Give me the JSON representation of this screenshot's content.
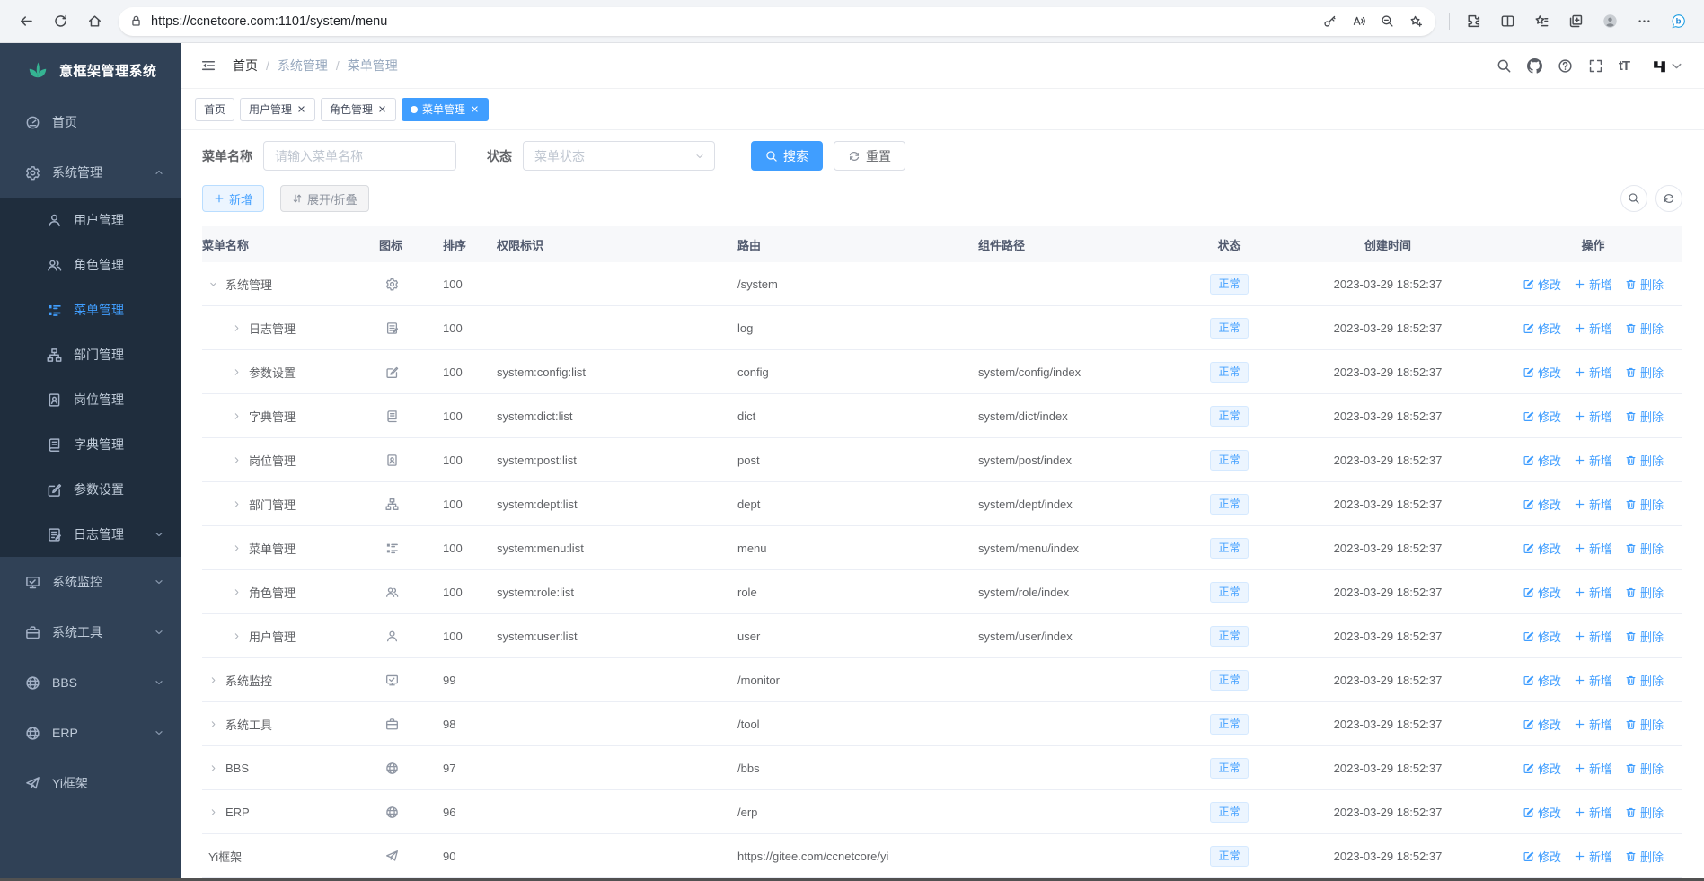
{
  "browser": {
    "url": "https://ccnetcore.com:1101/system/menu",
    "left_icons": [
      "back-icon",
      "reload-icon",
      "home-icon"
    ],
    "pill_icons": [
      "lock-icon",
      "key-icon",
      "read-aloud-icon",
      "zoom-out-icon",
      "add-favorite-icon"
    ],
    "right_icons": [
      "extensions-icon",
      "split-screen-icon",
      "favorites-icon",
      "collections-icon",
      "profile-avatar",
      "more-icon",
      "bing-chat-icon"
    ],
    "bing_letter": "b"
  },
  "theme": {
    "primary": "#409eff",
    "sidebar_bg": "#304156",
    "sidebar_submenu_bg": "#1f2d3d",
    "sidebar_text": "#bfcbd9",
    "logo_green": "#35b392",
    "status_pill_bg": "#ecf5ff",
    "table_border": "#ebeef5"
  },
  "sidebar": {
    "logo_text": "意框架管理系统",
    "items": [
      {
        "id": "home",
        "icon": "dashboard",
        "label": "首页"
      },
      {
        "id": "system",
        "icon": "gear",
        "label": "系统管理",
        "arrow": "up",
        "children": [
          {
            "id": "user",
            "icon": "user",
            "label": "用户管理"
          },
          {
            "id": "role",
            "icon": "users",
            "label": "角色管理"
          },
          {
            "id": "menu",
            "icon": "menu-tree",
            "label": "菜单管理",
            "active": true
          },
          {
            "id": "dept",
            "icon": "org-tree",
            "label": "部门管理"
          },
          {
            "id": "post",
            "icon": "id-badge",
            "label": "岗位管理"
          },
          {
            "id": "dict",
            "icon": "book",
            "label": "字典管理"
          },
          {
            "id": "config",
            "icon": "edit",
            "label": "参数设置"
          },
          {
            "id": "log",
            "icon": "log",
            "label": "日志管理",
            "arrow": "down"
          }
        ]
      },
      {
        "id": "monitor",
        "icon": "monitor",
        "label": "系统监控",
        "arrow": "down"
      },
      {
        "id": "tool",
        "icon": "briefcase",
        "label": "系统工具",
        "arrow": "down"
      },
      {
        "id": "bbs",
        "icon": "globe",
        "label": "BBS",
        "arrow": "down"
      },
      {
        "id": "erp",
        "icon": "globe",
        "label": "ERP",
        "arrow": "down"
      },
      {
        "id": "yi",
        "icon": "send",
        "label": "Yi框架"
      }
    ]
  },
  "navbar": {
    "breadcrumb": [
      "首页",
      "系统管理",
      "菜单管理"
    ],
    "separator": "/",
    "font_size_label": "tT",
    "icons": [
      "search-icon",
      "github-icon",
      "help-icon",
      "fullscreen-icon",
      "font-size-icon",
      "yi-logo",
      "chevron-down-icon"
    ]
  },
  "tabs": [
    {
      "label": "首页",
      "closable": false,
      "active": false
    },
    {
      "label": "用户管理",
      "closable": true,
      "active": false
    },
    {
      "label": "角色管理",
      "closable": true,
      "active": false
    },
    {
      "label": "菜单管理",
      "closable": true,
      "active": true
    }
  ],
  "filters": {
    "name_label": "菜单名称",
    "name_placeholder": "请输入菜单名称",
    "name_value": "",
    "status_label": "状态",
    "status_placeholder": "菜单状态",
    "search_label": "搜索",
    "reset_label": "重置"
  },
  "toolbar": {
    "add_label": "新增",
    "toggle_label": "展开/折叠"
  },
  "table": {
    "headers": [
      "菜单名称",
      "图标",
      "排序",
      "权限标识",
      "路由",
      "组件路径",
      "状态",
      "创建时间",
      "操作"
    ],
    "actions": {
      "edit": "修改",
      "add": "新增",
      "delete": "删除"
    },
    "rows": [
      {
        "name": "系统管理",
        "icon": "gear",
        "sort": "100",
        "perm": "",
        "route": "/system",
        "component": "",
        "status": "正常",
        "time": "2023-03-29 18:52:37",
        "level": 0,
        "expand": "open"
      },
      {
        "name": "日志管理",
        "icon": "log",
        "sort": "100",
        "perm": "",
        "route": "log",
        "component": "",
        "status": "正常",
        "time": "2023-03-29 18:52:37",
        "level": 1,
        "expand": "closed"
      },
      {
        "name": "参数设置",
        "icon": "edit",
        "sort": "100",
        "perm": "system:config:list",
        "route": "config",
        "component": "system/config/index",
        "status": "正常",
        "time": "2023-03-29 18:52:37",
        "level": 1,
        "expand": "closed"
      },
      {
        "name": "字典管理",
        "icon": "book",
        "sort": "100",
        "perm": "system:dict:list",
        "route": "dict",
        "component": "system/dict/index",
        "status": "正常",
        "time": "2023-03-29 18:52:37",
        "level": 1,
        "expand": "closed"
      },
      {
        "name": "岗位管理",
        "icon": "id-badge",
        "sort": "100",
        "perm": "system:post:list",
        "route": "post",
        "component": "system/post/index",
        "status": "正常",
        "time": "2023-03-29 18:52:37",
        "level": 1,
        "expand": "closed"
      },
      {
        "name": "部门管理",
        "icon": "org-tree",
        "sort": "100",
        "perm": "system:dept:list",
        "route": "dept",
        "component": "system/dept/index",
        "status": "正常",
        "time": "2023-03-29 18:52:37",
        "level": 1,
        "expand": "closed"
      },
      {
        "name": "菜单管理",
        "icon": "menu-tree",
        "sort": "100",
        "perm": "system:menu:list",
        "route": "menu",
        "component": "system/menu/index",
        "status": "正常",
        "time": "2023-03-29 18:52:37",
        "level": 1,
        "expand": "closed"
      },
      {
        "name": "角色管理",
        "icon": "users",
        "sort": "100",
        "perm": "system:role:list",
        "route": "role",
        "component": "system/role/index",
        "status": "正常",
        "time": "2023-03-29 18:52:37",
        "level": 1,
        "expand": "closed"
      },
      {
        "name": "用户管理",
        "icon": "user",
        "sort": "100",
        "perm": "system:user:list",
        "route": "user",
        "component": "system/user/index",
        "status": "正常",
        "time": "2023-03-29 18:52:37",
        "level": 1,
        "expand": "closed"
      },
      {
        "name": "系统监控",
        "icon": "monitor",
        "sort": "99",
        "perm": "",
        "route": "/monitor",
        "component": "",
        "status": "正常",
        "time": "2023-03-29 18:52:37",
        "level": 0,
        "expand": "closed"
      },
      {
        "name": "系统工具",
        "icon": "briefcase",
        "sort": "98",
        "perm": "",
        "route": "/tool",
        "component": "",
        "status": "正常",
        "time": "2023-03-29 18:52:37",
        "level": 0,
        "expand": "closed"
      },
      {
        "name": "BBS",
        "icon": "globe",
        "sort": "97",
        "perm": "",
        "route": "/bbs",
        "component": "",
        "status": "正常",
        "time": "2023-03-29 18:52:37",
        "level": 0,
        "expand": "closed"
      },
      {
        "name": "ERP",
        "icon": "globe",
        "sort": "96",
        "perm": "",
        "route": "/erp",
        "component": "",
        "status": "正常",
        "time": "2023-03-29 18:52:37",
        "level": 0,
        "expand": "closed"
      },
      {
        "name": "Yi框架",
        "icon": "send",
        "sort": "90",
        "perm": "",
        "route": "https://gitee.com/ccnetcore/yi",
        "component": "",
        "status": "正常",
        "time": "2023-03-29 18:52:37",
        "level": 0,
        "expand": "none"
      }
    ]
  }
}
